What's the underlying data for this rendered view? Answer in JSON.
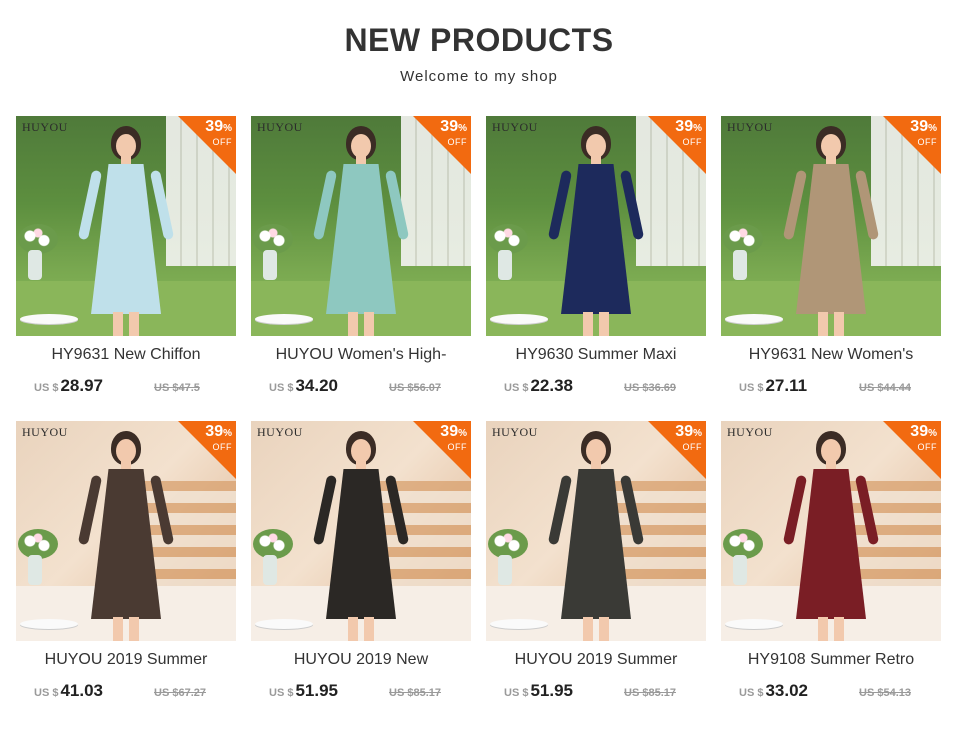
{
  "header": {
    "title": "NEW PRODUCTS",
    "subtitle": "Welcome to my shop"
  },
  "colors": {
    "badge": "#f26a10",
    "text": "#333333",
    "muted": "#9a9a9a"
  },
  "badge": {
    "percent": "39",
    "symbol": "%",
    "off": "OFF"
  },
  "products": [
    {
      "brand": "HUYOU",
      "name": "HY9631 New Chiffon",
      "currency": "US $",
      "price": "28.97",
      "old_price": "US $47.5",
      "dress_color": "#bfe0ea",
      "scene": "garden"
    },
    {
      "brand": "HUYOU",
      "name": "HUYOU Women's High-",
      "currency": "US $",
      "price": "34.20",
      "old_price": "US $56.07",
      "dress_color": "#8ec8c0",
      "scene": "garden"
    },
    {
      "brand": "HUYOU",
      "name": "HY9630 Summer Maxi",
      "currency": "US $",
      "price": "22.38",
      "old_price": "US $36.69",
      "dress_color": "#1d2a5c",
      "scene": "garden"
    },
    {
      "brand": "HUYOU",
      "name": "HY9631 New Women's",
      "currency": "US $",
      "price": "27.11",
      "old_price": "US $44.44",
      "dress_color": "#b09677",
      "scene": "garden"
    },
    {
      "brand": "HUYOU",
      "name": "HUYOU 2019 Summer",
      "currency": "US $",
      "price": "41.03",
      "old_price": "US $67.27",
      "dress_color": "#4a3a32",
      "scene": "stairs"
    },
    {
      "brand": "HUYOU",
      "name": "HUYOU 2019 New",
      "currency": "US $",
      "price": "51.95",
      "old_price": "US $85.17",
      "dress_color": "#2b2825",
      "scene": "stairs"
    },
    {
      "brand": "HUYOU",
      "name": "HUYOU 2019 Summer",
      "currency": "US $",
      "price": "51.95",
      "old_price": "US $85.17",
      "dress_color": "#3a3a36",
      "scene": "stairs"
    },
    {
      "brand": "HUYOU",
      "name": "HY9108 Summer Retro",
      "currency": "US $",
      "price": "33.02",
      "old_price": "US $54.13",
      "dress_color": "#7a1e25",
      "scene": "stairs"
    }
  ]
}
